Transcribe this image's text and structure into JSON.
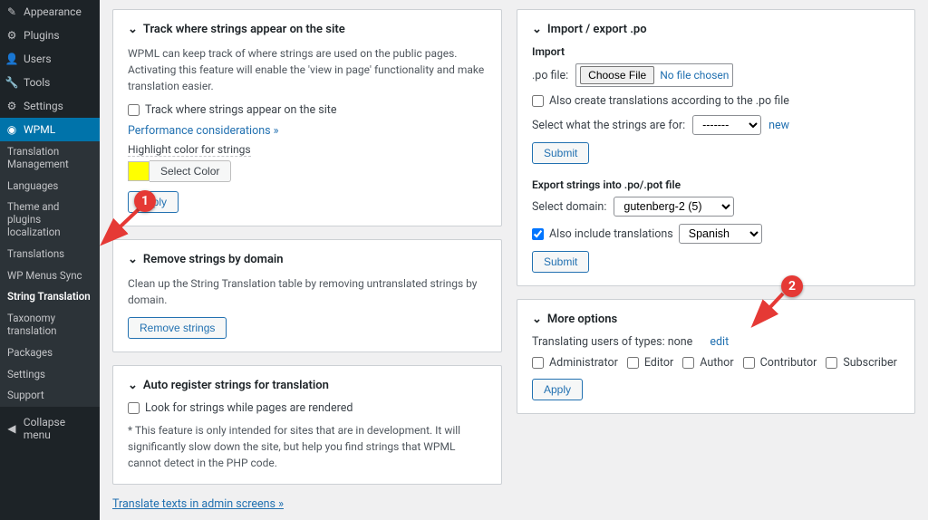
{
  "sidebar": {
    "top": [
      {
        "icon": "appearance-icon",
        "glyph": "✎",
        "label": "Appearance"
      },
      {
        "icon": "plugins-icon",
        "glyph": "⚙",
        "label": "Plugins"
      },
      {
        "icon": "users-icon",
        "glyph": "👤",
        "label": "Users"
      },
      {
        "icon": "tools-icon",
        "glyph": "🔧",
        "label": "Tools"
      },
      {
        "icon": "settings-icon",
        "glyph": "⚙",
        "label": "Settings"
      }
    ],
    "current": {
      "icon": "wpml-icon",
      "glyph": "◉",
      "label": "WPML"
    },
    "submenu": [
      "Translation Management",
      "Languages",
      "Theme and plugins localization",
      "Translations",
      "WP Menus Sync",
      "String Translation",
      "Taxonomy translation",
      "Packages",
      "Settings",
      "Support"
    ],
    "submenu_active": "String Translation",
    "collapse": "Collapse menu"
  },
  "track": {
    "title": "Track where strings appear on the site",
    "desc": "WPML can keep track of where strings are used on the public pages. Activating this feature will enable the 'view in page' functionality and make translation easier.",
    "chk_label": "Track where strings appear on the site",
    "perf_link": "Performance considerations »",
    "highlight_label": "Highlight color for strings",
    "select_color": "Select Color",
    "apply": "Apply"
  },
  "remove": {
    "title": "Remove strings by domain",
    "desc": "Clean up the String Translation table by removing untranslated strings by domain.",
    "btn": "Remove strings"
  },
  "auto": {
    "title": "Auto register strings for translation",
    "chk_label": "Look for strings while pages are rendered",
    "note": "* This feature is only intended for sites that are in development. It will significantly slow down the site, but help you find strings that WPML cannot detect in the PHP code."
  },
  "impexp": {
    "title": "Import / export .po",
    "import_label": "Import",
    "po_label": ".po file:",
    "choose": "Choose File",
    "no_file": "No file chosen",
    "also_create": "Also create translations according to the .po file",
    "select_what": "Select what the strings are for:",
    "select_placeholder": "-------",
    "new_link": "new",
    "submit": "Submit",
    "export_label": "Export strings into .po/.pot file",
    "select_domain": "Select domain:",
    "domain_value": "gutenberg-2 (5)",
    "also_include": "Also include translations",
    "lang_value": "Spanish"
  },
  "more": {
    "title": "More options",
    "translating": "Translating users of types: none",
    "edit": "edit",
    "roles": [
      "Administrator",
      "Editor",
      "Author",
      "Contributor",
      "Subscriber"
    ],
    "apply": "Apply"
  },
  "footer_link": "Translate texts in admin screens »",
  "markers": {
    "one": "1",
    "two": "2"
  }
}
